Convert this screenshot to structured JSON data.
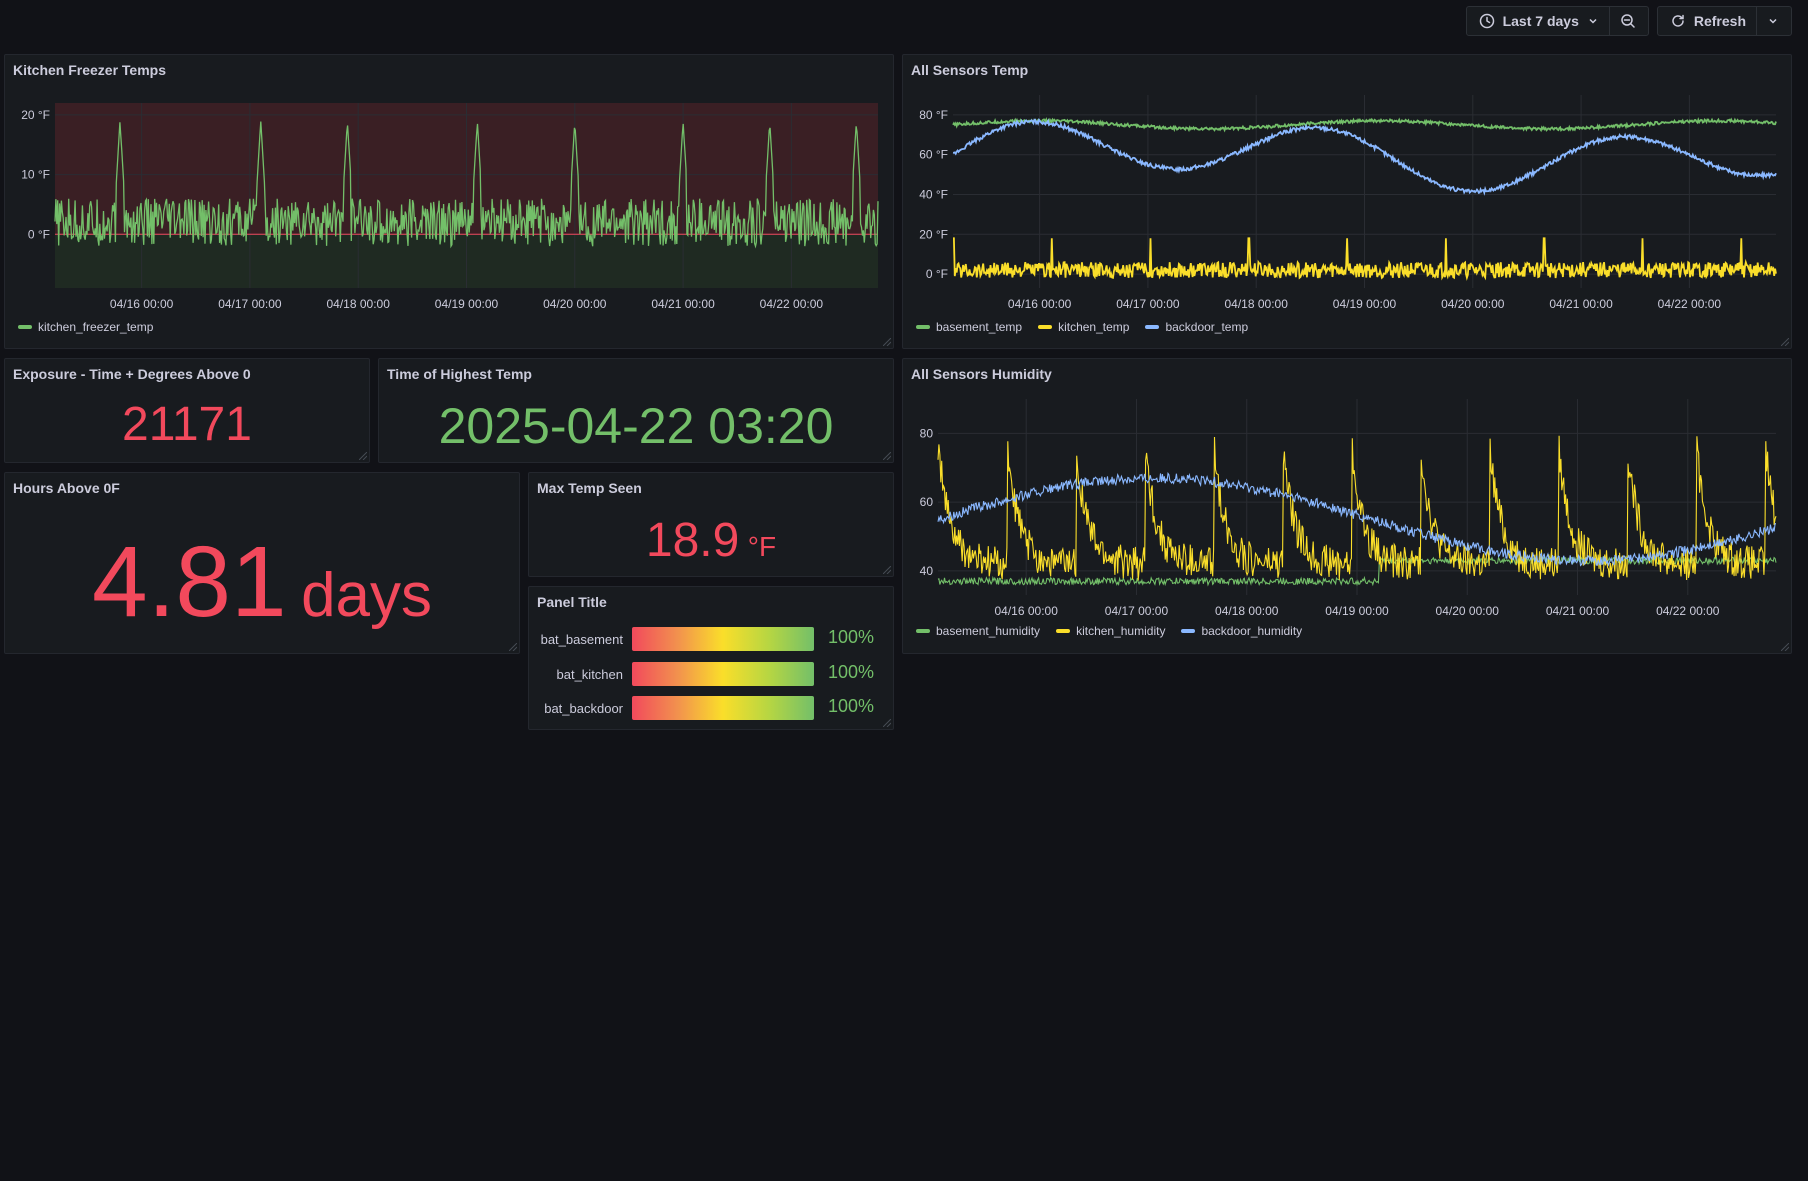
{
  "toolbar": {
    "time_range": "Last 7 days",
    "refresh_label": "Refresh"
  },
  "colors": {
    "green": "#73bf69",
    "yellow": "#fade2a",
    "blue": "#8ab8ff",
    "red": "#f2495c"
  },
  "panels": {
    "freezer": {
      "title": "Kitchen Freezer Temps"
    },
    "all_temp": {
      "title": "All Sensors Temp"
    },
    "exposure": {
      "title": "Exposure - Time + Degrees Above 0",
      "value": "21171"
    },
    "highest_time": {
      "title": "Time of Highest Temp",
      "value": "2025-04-22 03:20"
    },
    "hours_above": {
      "title": "Hours Above 0F",
      "value": "4.81",
      "unit": "days"
    },
    "max_temp": {
      "title": "Max Temp Seen",
      "value": "18.9",
      "unit": "°F"
    },
    "battery": {
      "title": "Panel Title",
      "rows": [
        {
          "label": "bat_basement",
          "value": "100%"
        },
        {
          "label": "bat_kitchen",
          "value": "100%"
        },
        {
          "label": "bat_backdoor",
          "value": "100%"
        }
      ]
    },
    "humidity": {
      "title": "All Sensors Humidity"
    }
  },
  "chart_data": [
    {
      "type": "line",
      "title": "Kitchen Freezer Temps",
      "x_ticks": [
        "04/16 00:00",
        "04/17 00:00",
        "04/18 00:00",
        "04/19 00:00",
        "04/20 00:00",
        "04/21 00:00",
        "04/22 00:00"
      ],
      "y_ticks": [
        "20 °F",
        "10 °F",
        "0 °F"
      ],
      "ylim": [
        -9,
        22
      ],
      "threshold": 0,
      "series": [
        {
          "name": "kitchen_freezer_temp",
          "color": "#73bf69",
          "baseline": 2,
          "spike_height": 18.9,
          "spike_days": [
            0.6,
            1.9,
            2.7,
            3.9,
            4.8,
            5.8,
            6.6,
            7.4,
            8.0
          ]
        }
      ]
    },
    {
      "type": "line",
      "title": "All Sensors Temp",
      "x_ticks": [
        "04/16 00:00",
        "04/17 00:00",
        "04/18 00:00",
        "04/19 00:00",
        "04/20 00:00",
        "04/21 00:00",
        "04/22 00:00"
      ],
      "y_ticks": [
        "80 °F",
        "60 °F",
        "40 °F",
        "20 °F",
        "0 °F"
      ],
      "ylim": [
        -7,
        90
      ],
      "series": [
        {
          "name": "basement_temp",
          "color": "#73bf69",
          "level": 75
        },
        {
          "name": "kitchen_temp",
          "color": "#fade2a",
          "level": 2
        },
        {
          "name": "backdoor_temp",
          "color": "#8ab8ff",
          "level": 60
        }
      ]
    },
    {
      "type": "line",
      "title": "All Sensors Humidity",
      "x_ticks": [
        "04/16 00:00",
        "04/17 00:00",
        "04/18 00:00",
        "04/19 00:00",
        "04/20 00:00",
        "04/21 00:00",
        "04/22 00:00"
      ],
      "y_ticks": [
        "80",
        "60",
        "40"
      ],
      "ylim": [
        33,
        90
      ],
      "series": [
        {
          "name": "basement_humidity",
          "color": "#73bf69",
          "level": 37
        },
        {
          "name": "kitchen_humidity",
          "color": "#fade2a",
          "level": 47
        },
        {
          "name": "backdoor_humidity",
          "color": "#8ab8ff",
          "level": 55
        }
      ]
    }
  ]
}
